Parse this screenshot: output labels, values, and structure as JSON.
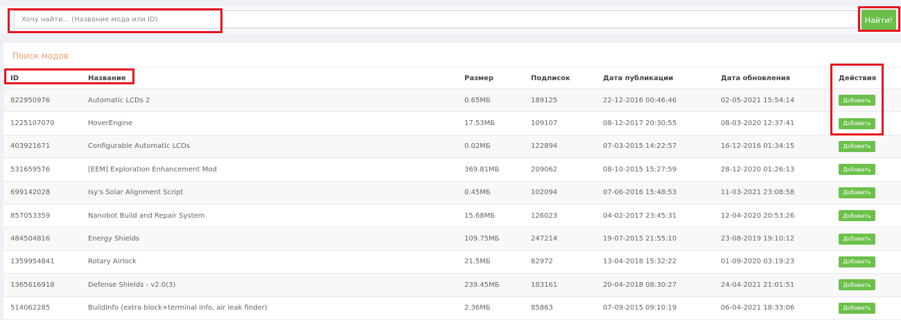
{
  "search": {
    "placeholder": "Хочу найти... (Название мода или ID)",
    "value": "",
    "button_label": "Найти!"
  },
  "panel": {
    "title": "Поиск модов"
  },
  "table": {
    "headers": {
      "id": "ID",
      "name": "Название",
      "size": "Размер",
      "subs": "Подписок",
      "published": "Дата публикации",
      "updated": "Дата обновления",
      "actions": "Действия"
    },
    "add_label": "Добавить",
    "rows": [
      {
        "id": "822950976",
        "name": "Automatic LCDs 2",
        "size": "0.65МБ",
        "subs": "189125",
        "published": "22-12-2016 00:46:46",
        "updated": "02-05-2021 15:54:14"
      },
      {
        "id": "1225107070",
        "name": "HoverEngine",
        "size": "17.53МБ",
        "subs": "109107",
        "published": "08-12-2017 20:30:55",
        "updated": "08-03-2020 12:37:41"
      },
      {
        "id": "403921671",
        "name": "Configurable Automatic LCDs",
        "size": "0.02МБ",
        "subs": "122894",
        "published": "07-03-2015 14:22:57",
        "updated": "16-12-2016 01:34:15"
      },
      {
        "id": "531659576",
        "name": "[EEM] Exploration Enhancement Mod",
        "size": "369.81МБ",
        "subs": "209062",
        "published": "08-10-2015 15:27:59",
        "updated": "28-12-2020 01:26:13"
      },
      {
        "id": "699142028",
        "name": "Isy's Solar Alignment Script",
        "size": "0.45МБ",
        "subs": "102094",
        "published": "07-06-2016 15:48:53",
        "updated": "11-03-2021 23:08:58"
      },
      {
        "id": "857053359",
        "name": "Nanobot Build and Repair System",
        "size": "15.68МБ",
        "subs": "126023",
        "published": "04-02-2017 23:45:31",
        "updated": "12-04-2020 20:53:26"
      },
      {
        "id": "484504816",
        "name": "Energy Shields",
        "size": "109.75МБ",
        "subs": "247214",
        "published": "19-07-2015 21:55:10",
        "updated": "23-08-2019 19:10:12"
      },
      {
        "id": "1359954841",
        "name": "Rotary Airlock",
        "size": "21.5МБ",
        "subs": "82972",
        "published": "13-04-2018 15:32:22",
        "updated": "01-09-2020 03:19:23"
      },
      {
        "id": "1365616918",
        "name": "Defense Shields - v2.0(3)",
        "size": "239.45МБ",
        "subs": "183161",
        "published": "20-04-2018 08:30:27",
        "updated": "24-04-2021 21:01:51"
      },
      {
        "id": "514062285",
        "name": "BuildInfo (extra block+terminal info, air leak finder)",
        "size": "2.36МБ",
        "subs": "85863",
        "published": "07-09-2015 09:10:19",
        "updated": "06-04-2021 18:33:06"
      }
    ]
  },
  "colors": {
    "accent_green": "#6cc04a",
    "title_orange": "#f0a070",
    "highlight_red": "#e8101c"
  }
}
